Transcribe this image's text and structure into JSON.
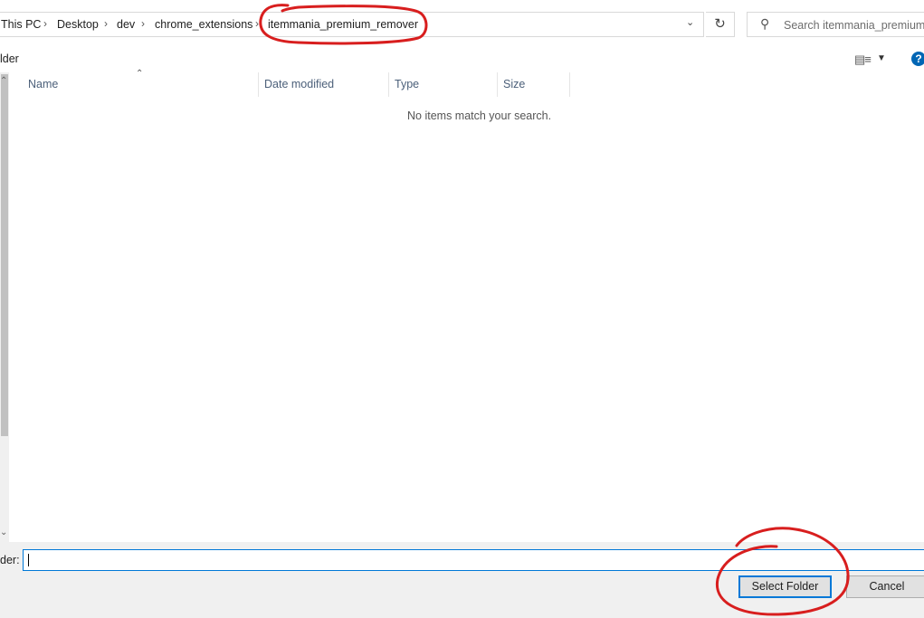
{
  "address_bar": {
    "crumbs": [
      "This PC",
      "Desktop",
      "dev",
      "chrome_extensions",
      "itemmania_premium_remover"
    ],
    "separator": "›",
    "dropdown_icon": "chevron-down-icon",
    "refresh_icon": "refresh-icon"
  },
  "search": {
    "placeholder": "Search itemmania_premium..."
  },
  "toolbar": {
    "new_folder_label": "lder",
    "view_icon": "details-view-icon",
    "help_icon": "help-icon",
    "help_glyph": "?"
  },
  "file_list": {
    "columns": [
      "Name",
      "Date modified",
      "Type",
      "Size"
    ],
    "sorted_by": "Name",
    "empty_message": "No items match your search."
  },
  "footer": {
    "folder_label": "der:",
    "folder_value": "",
    "select_button": "Select Folder",
    "cancel_button": "Cancel"
  },
  "annotations": {
    "color": "#d81e1e",
    "circled": [
      "itemmania_premium_remover",
      "Select Folder"
    ]
  }
}
